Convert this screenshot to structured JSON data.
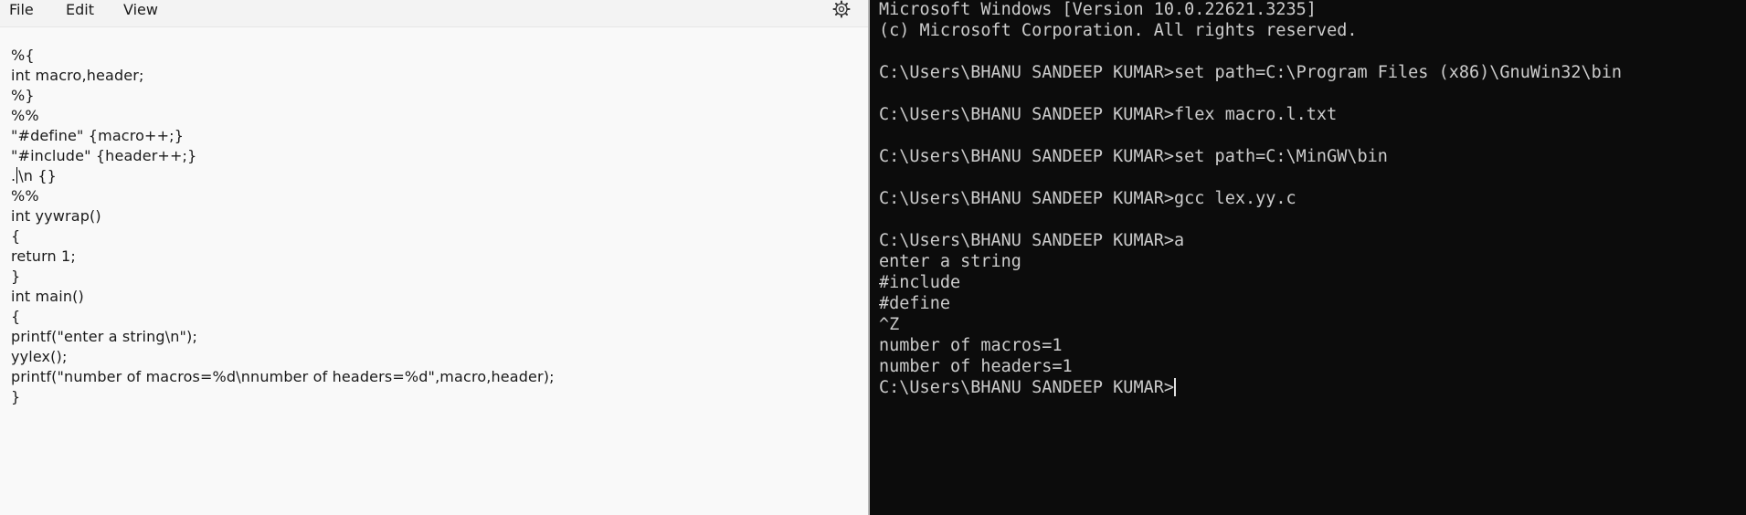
{
  "notepad": {
    "menu": {
      "file": "File",
      "edit": "Edit",
      "view": "View"
    },
    "settings_icon": "gear-icon",
    "lines": [
      "%{",
      "int macro,header;",
      "%}",
      "%%",
      "\"#define\" {macro++;}",
      "\"#include\" {header++;}",
      ".",
      "%%",
      "int yywrap()",
      "{",
      "return 1;",
      "}",
      "int main()",
      "{",
      "printf(\"enter a string\\n\");",
      "yylex();",
      "printf(\"number of macros=%d\\nnumber of headers=%d\",macro,header);",
      "}"
    ],
    "caret_line_suffix": "\\n {}"
  },
  "terminal": {
    "lines": [
      "Microsoft Windows [Version 10.0.22621.3235]",
      "(c) Microsoft Corporation. All rights reserved.",
      "",
      "C:\\Users\\BHANU SANDEEP KUMAR>set path=C:\\Program Files (x86)\\GnuWin32\\bin",
      "",
      "C:\\Users\\BHANU SANDEEP KUMAR>flex macro.l.txt",
      "",
      "C:\\Users\\BHANU SANDEEP KUMAR>set path=C:\\MinGW\\bin",
      "",
      "C:\\Users\\BHANU SANDEEP KUMAR>gcc lex.yy.c",
      "",
      "C:\\Users\\BHANU SANDEEP KUMAR>a",
      "enter a string",
      "#include",
      "#define",
      "^Z",
      "number of macros=1",
      "number of headers=1"
    ],
    "prompt": "C:\\Users\\BHANU SANDEEP KUMAR>"
  }
}
